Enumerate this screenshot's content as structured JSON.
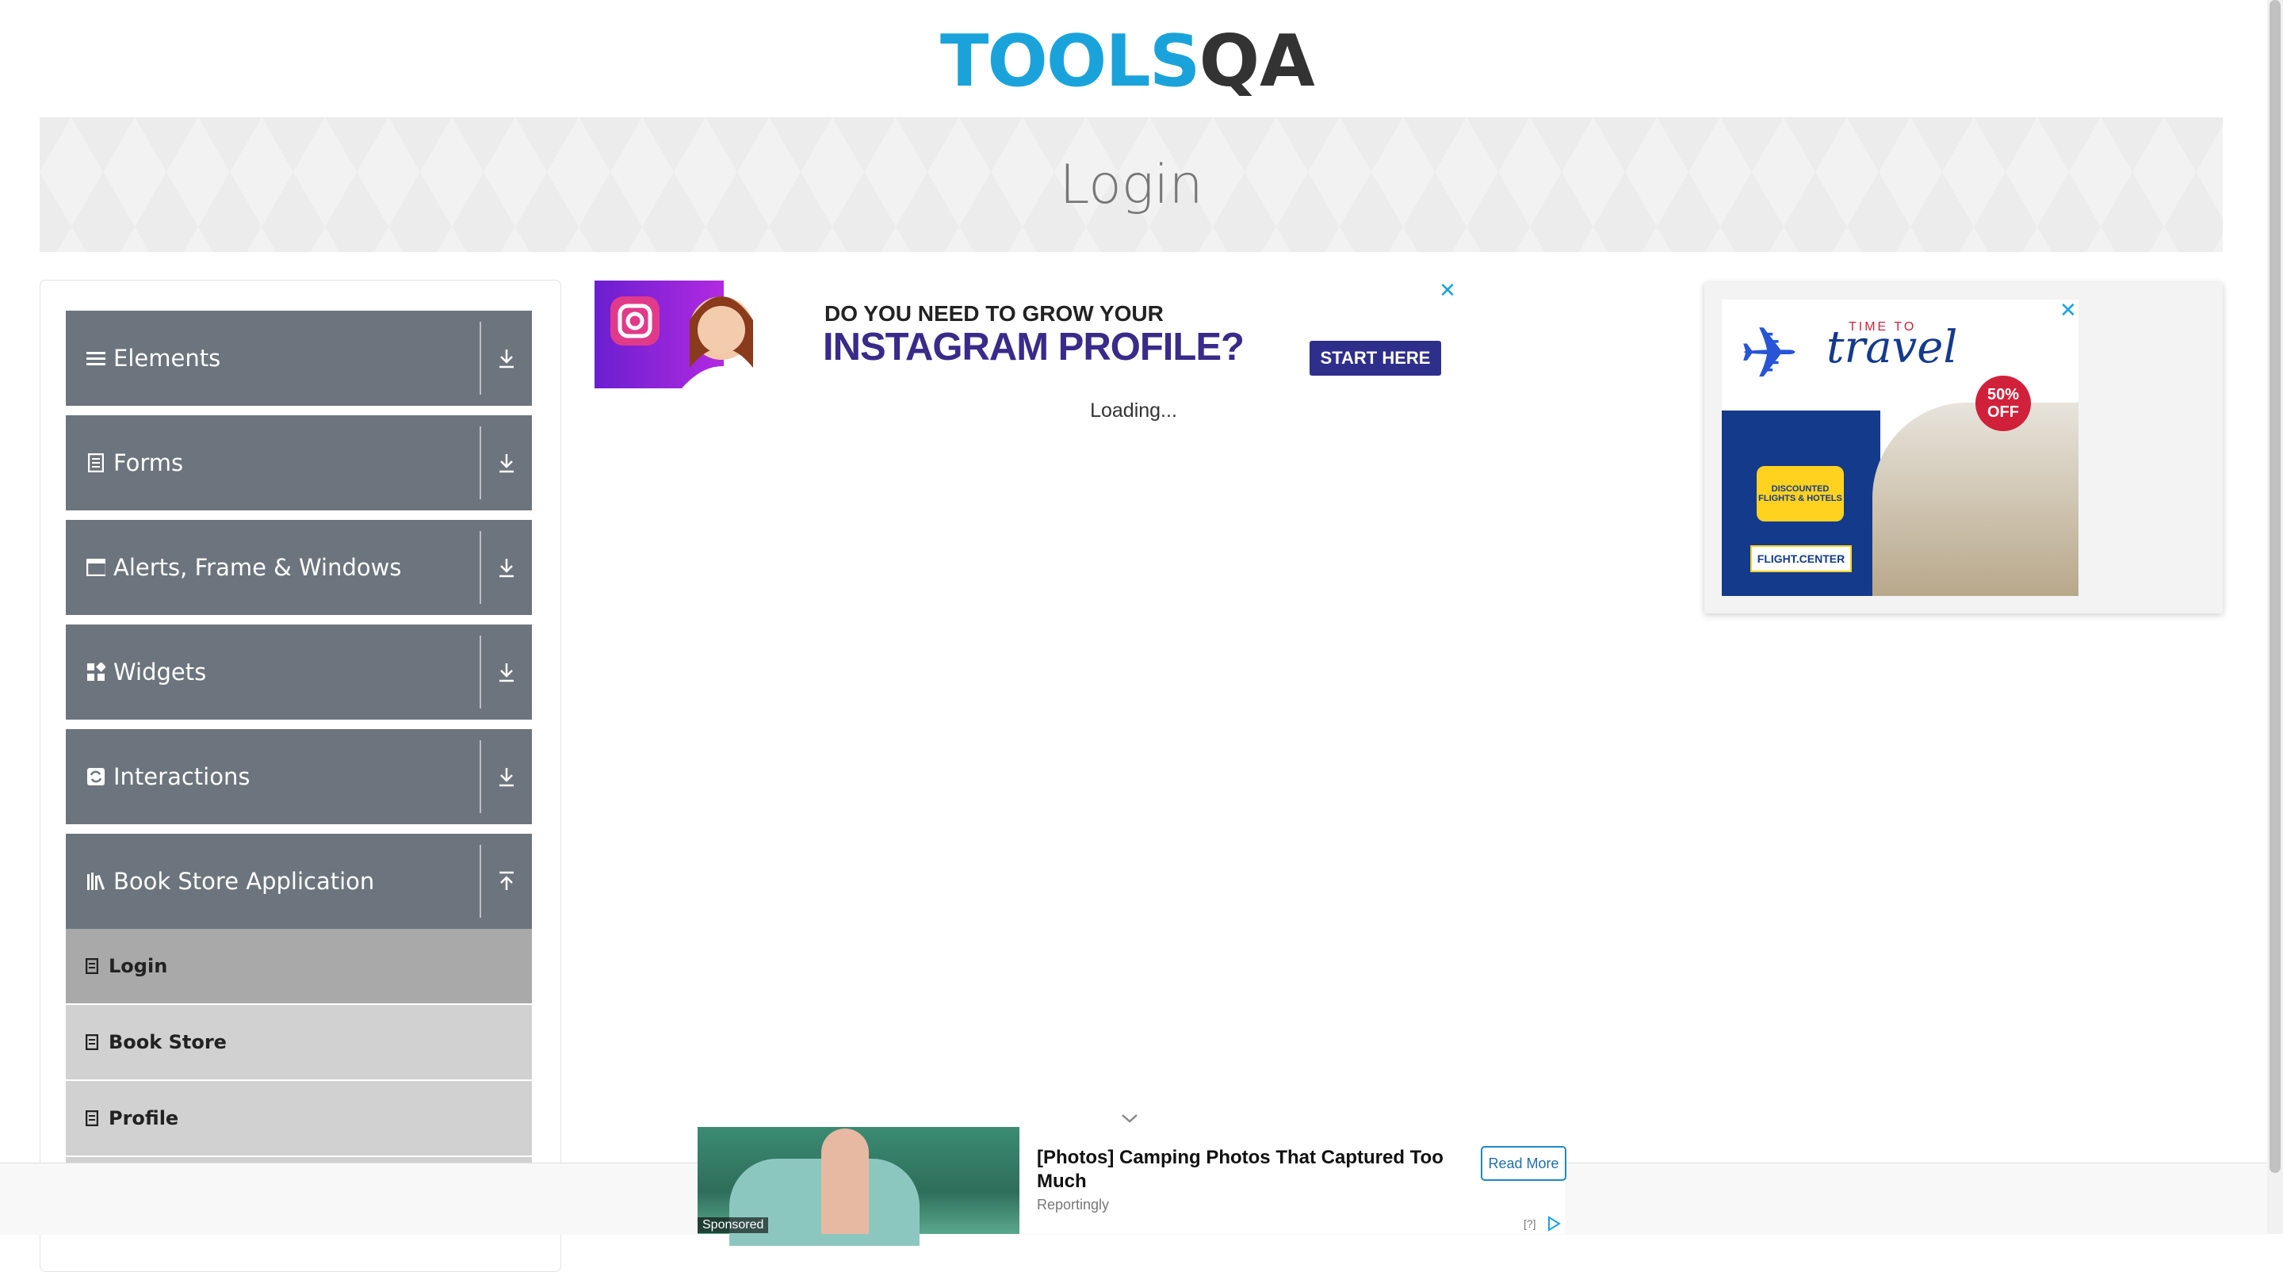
{
  "header": {
    "logo_part1": "TOOLS",
    "logo_part2": "QA"
  },
  "banner": {
    "title": "Login"
  },
  "sidebar": {
    "groups": [
      {
        "label": "Elements",
        "icon": "menu-icon",
        "state": "collapsed"
      },
      {
        "label": "Forms",
        "icon": "form-icon",
        "state": "collapsed"
      },
      {
        "label": "Alerts, Frame & Windows",
        "icon": "window-icon",
        "state": "collapsed"
      },
      {
        "label": "Widgets",
        "icon": "widgets-icon",
        "state": "collapsed"
      },
      {
        "label": "Interactions",
        "icon": "interactions-icon",
        "state": "collapsed"
      },
      {
        "label": "Book Store Application",
        "icon": "books-icon",
        "state": "expanded"
      }
    ],
    "subitems": [
      {
        "label": "Login",
        "active": true
      },
      {
        "label": "Book Store",
        "active": false
      },
      {
        "label": "Profile",
        "active": false
      }
    ]
  },
  "ad_top": {
    "line1": "DO YOU NEED TO GROW YOUR",
    "line2": "INSTAGRAM PROFILE?",
    "cta": "START HERE",
    "close": "✕"
  },
  "main": {
    "loading": "Loading..."
  },
  "ad_side": {
    "time_small": "TIME TO",
    "time_big": "travel",
    "badge": "50% OFF",
    "yellow_box": "DISCOUNTED FLIGHTS & HOTELS",
    "brand": "FLIGHT.CENTER",
    "close": "✕"
  },
  "ad_bottom": {
    "sponsored": "Sponsored",
    "headline": "[Photos] Camping Photos That Captured Too Much",
    "source": "Reportingly",
    "cta": "Read More",
    "info": "[?]"
  },
  "colors": {
    "sidebar_group_bg": "#6c757d",
    "sidebar_sub_bg": "#d1d1d1",
    "sidebar_sub_active_bg": "#a9a9a9",
    "logo_blue": "#1aa3db"
  }
}
